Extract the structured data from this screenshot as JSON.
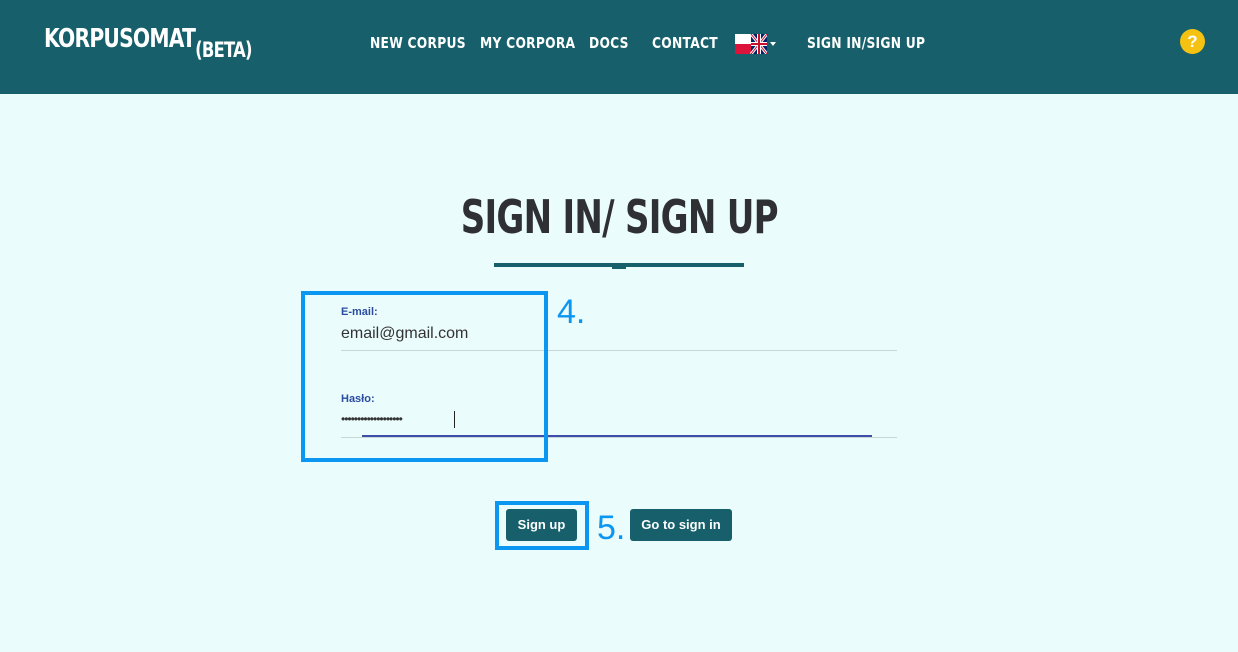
{
  "header": {
    "brand": "KORPUSOMAT",
    "brand_suffix": "(BETA)",
    "nav": [
      {
        "label": "NEW CORPUS"
      },
      {
        "label": "MY CORPORA"
      },
      {
        "label": "DOCS"
      },
      {
        "label": "CONTACT"
      },
      {
        "label": "SIGN IN/SIGN UP"
      }
    ],
    "language_flag_icon": "pl-uk-flag-icon",
    "help": "?"
  },
  "page": {
    "title": "SIGN IN/ SIGN UP"
  },
  "form": {
    "email_label": "E-mail:",
    "email_value": "email@gmail.com",
    "password_label": "Hasło:",
    "password_value": "•••••••••••••••••••"
  },
  "buttons": {
    "sign_up": "Sign up",
    "go_to_sign_in": "Go to sign in"
  },
  "annotations": {
    "step4": "4.",
    "step5": "5."
  },
  "colors": {
    "header_bg": "#17606b",
    "page_bg": "#eafcfc",
    "accent": "#0b96f2",
    "help": "#f5c211"
  }
}
